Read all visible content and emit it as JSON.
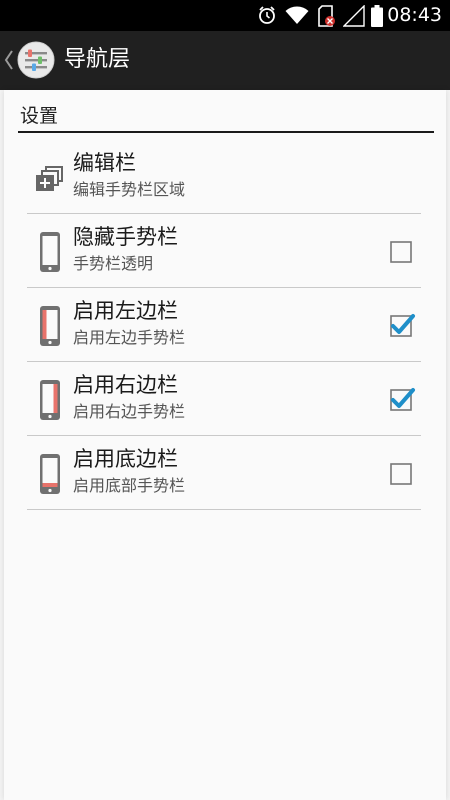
{
  "status_bar": {
    "time": "08:43",
    "icons": [
      "alarm-icon",
      "wifi-icon",
      "sd-card-error-icon",
      "signal-icon",
      "battery-icon"
    ]
  },
  "action_bar": {
    "title": "导航层"
  },
  "settings": {
    "section_title": "设置",
    "items": [
      {
        "title": "编辑栏",
        "summary": "编辑手势栏区域",
        "icon": "add-layers-icon",
        "has_checkbox": false
      },
      {
        "title": "隐藏手势栏",
        "summary": "手势栏透明",
        "icon": "phone-icon",
        "has_checkbox": true,
        "checked": false
      },
      {
        "title": "启用左边栏",
        "summary": "启用左边手势栏",
        "icon": "phone-left-edge-icon",
        "has_checkbox": true,
        "checked": true
      },
      {
        "title": "启用右边栏",
        "summary": "启用右边手势栏",
        "icon": "phone-right-edge-icon",
        "has_checkbox": true,
        "checked": true
      },
      {
        "title": "启用底边栏",
        "summary": "启用底部手势栏",
        "icon": "phone-bottom-edge-icon",
        "has_checkbox": true,
        "checked": false
      }
    ]
  },
  "colors": {
    "accent": "#1f8fc9",
    "edge_highlight": "#e8736b",
    "action_bar": "#202020"
  }
}
